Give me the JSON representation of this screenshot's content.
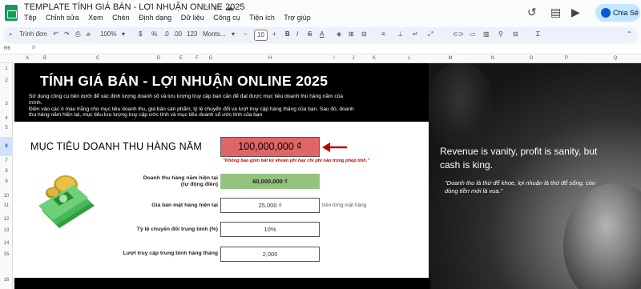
{
  "doc": {
    "title": "TEMPLATE TÍNH GIÁ BÁN - LỢI NHUẬN ONLINE 2025",
    "menu": [
      "Tệp",
      "Chỉnh sửa",
      "Xem",
      "Chèn",
      "Định dạng",
      "Dữ liệu",
      "Công cụ",
      "Tiện ích",
      "Trợ giúp"
    ],
    "share_label": "Chia Sẻ"
  },
  "toolbar": {
    "search": "Trình đơn",
    "zoom": "100%",
    "currency": "$",
    "percent": "%",
    "dec_less": ".0",
    "dec_more": ".00",
    "number_format": "123",
    "font": "Monts...",
    "font_size": "10"
  },
  "formula_bar": {
    "cell_ref": "R6"
  },
  "columns": [
    "A",
    "B",
    "C",
    "D",
    "E",
    "F",
    "G",
    "H",
    "I",
    "J",
    "K",
    "L",
    "M",
    "N",
    "O",
    "P",
    "Q"
  ],
  "rows": [
    "1",
    "2",
    "3",
    "4",
    "5",
    "6",
    "7",
    "8",
    "9",
    "10",
    "11",
    "12",
    "13",
    "14",
    "15",
    "16"
  ],
  "selected_row": "6",
  "banner": {
    "title": "TÍNH GIÁ BÁN - LỢI NHUẬN ONLINE 2025",
    "desc1": "Sử dụng công cụ bên dưới để xác định lượng doanh số và lưu lượng truy cập bạn cần để đạt được mục tiêu doanh thu hàng năm của mình.",
    "desc2": "Điền vào các ô màu trắng cho mục tiêu doanh thu, giá bán sản phẩm, tỷ lệ chuyển đổi và lượt truy cập hàng tháng của bạn. Sau đó, doanh thu hàng năm hiện tại, mục tiêu lưu lượng truy cập ước tính và mục tiêu doanh số ước tính của bạn"
  },
  "main": {
    "target_label": "MỤC TIÊU DOANH THU HÀNG NĂM",
    "target_value": "100,000,000 ₫",
    "target_note": "\"Không bao gồm bất kỳ khoản phí hay chi phí nào trong phép tính.\"",
    "current_revenue_label": "Doanh thu hàng năm hiện tại",
    "current_revenue_sub": "(tự động điền)",
    "current_revenue_value": "60,000,000 ₫",
    "price_label": "Giá bán mặt hàng hiện tại",
    "price_value": "25,000 ₫",
    "price_unit": "trên từng mặt hàng",
    "conversion_label": "Tỷ lệ chuyển đổi trung bình (%)",
    "conversion_value": "10%",
    "traffic_label": "Lượt truy cập trung bình hàng tháng",
    "traffic_value": "2,000"
  },
  "quote": {
    "english": "Revenue is vanity, profit is sanity, but cash is king.",
    "vietnamese": "\"Doanh thu là thứ để khoe, lợi nhuận là thứ để sống, còn dòng tiền mới là vua.\""
  },
  "colors": {
    "target_fill": "#e06666",
    "green_fill": "#93c47d",
    "note_red": "#c00000",
    "arrow": "#c00000"
  }
}
